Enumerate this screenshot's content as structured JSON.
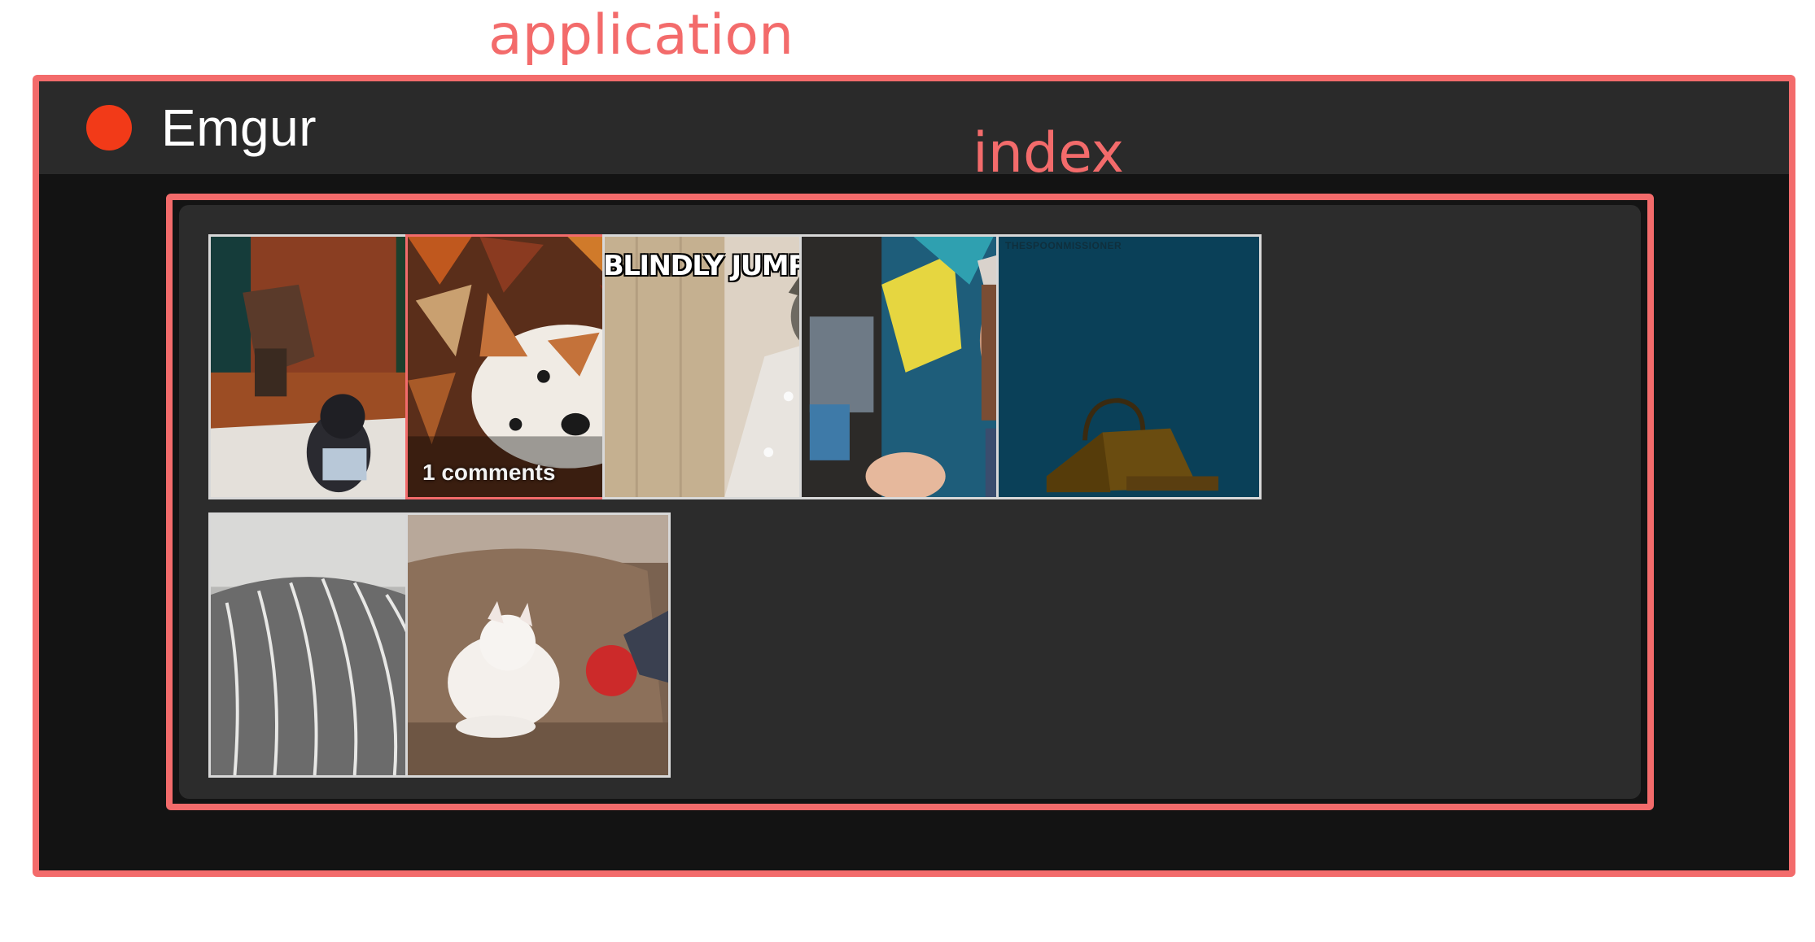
{
  "annotations": {
    "application_label": "application",
    "index_label": "index"
  },
  "app": {
    "title": "Emgur",
    "logo": "red-dot-logo"
  },
  "gallery": {
    "images": [
      {
        "subject": "small dog on a rug in a room",
        "comments_label": ""
      },
      {
        "subject": "puppy lying in autumn leaves",
        "comments_label": "1 comments",
        "active": true
      },
      {
        "subject": "cat jumping into packing peanuts",
        "caption": "BLINDLY JUMPS IN"
      },
      {
        "subject": "woman with cap smiling"
      },
      {
        "subject": "cartoon handbag under water",
        "watermark": "THESPOONMISSIONER"
      },
      {
        "subject": "waterfall"
      },
      {
        "subject": "white kitten with red yarn on couch"
      }
    ]
  },
  "colors": {
    "annotation": "#f36b6b",
    "logo": "#f23a18",
    "header": "#2a2a2a",
    "panel": "#2c2c2c"
  }
}
